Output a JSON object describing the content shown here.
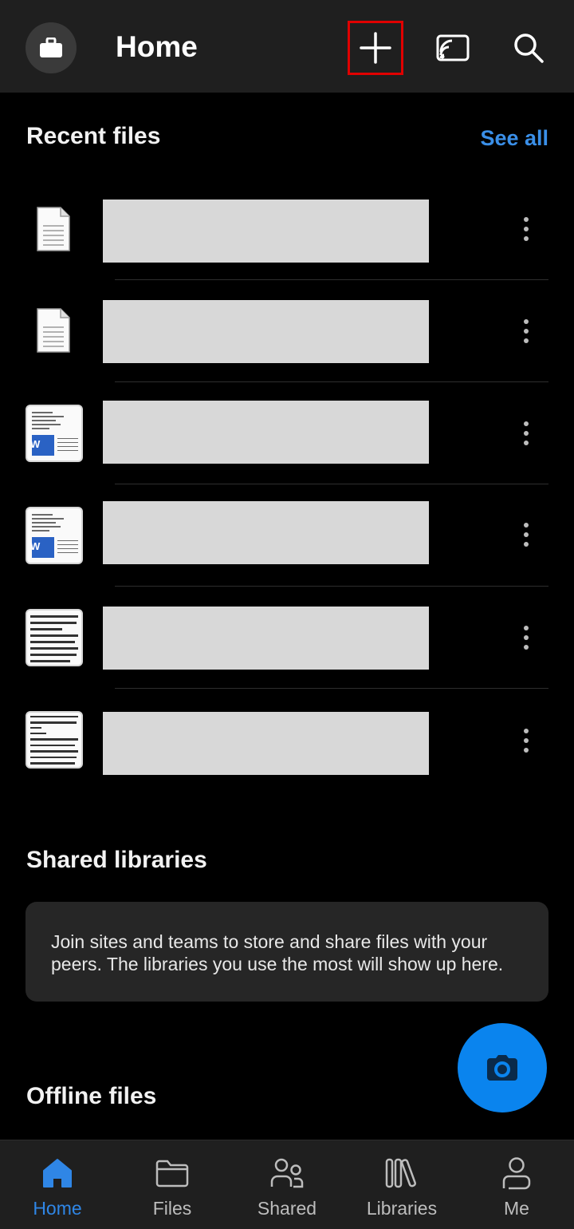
{
  "header": {
    "title": "Home",
    "avatar_icon": "briefcase-icon",
    "actions": [
      {
        "name": "add-icon"
      },
      {
        "name": "cast-icon"
      },
      {
        "name": "search-icon"
      }
    ]
  },
  "recent": {
    "title": "Recent files",
    "see_all": "See all",
    "files": [
      {
        "thumbnail": "generic-document"
      },
      {
        "thumbnail": "generic-document"
      },
      {
        "thumbnail": "word-document-preview"
      },
      {
        "thumbnail": "word-document-preview"
      },
      {
        "thumbnail": "text-document-preview"
      },
      {
        "thumbnail": "text-document-preview"
      }
    ]
  },
  "shared_libraries": {
    "title": "Shared libraries",
    "message": "Join sites and teams to store and share files with your peers. The libraries you use the most will show up here."
  },
  "offline": {
    "title": "Offline files"
  },
  "fab": {
    "icon": "camera-icon"
  },
  "nav": {
    "items": [
      {
        "label": "Home",
        "icon": "home-icon",
        "active": true
      },
      {
        "label": "Files",
        "icon": "folder-icon",
        "active": false
      },
      {
        "label": "Shared",
        "icon": "people-icon",
        "active": false
      },
      {
        "label": "Libraries",
        "icon": "libraries-icon",
        "active": false
      },
      {
        "label": "Me",
        "icon": "person-icon",
        "active": false
      }
    ]
  },
  "colors": {
    "accent": "#2f86e6",
    "fab": "#0a84ee",
    "highlight_border": "#e00000"
  }
}
